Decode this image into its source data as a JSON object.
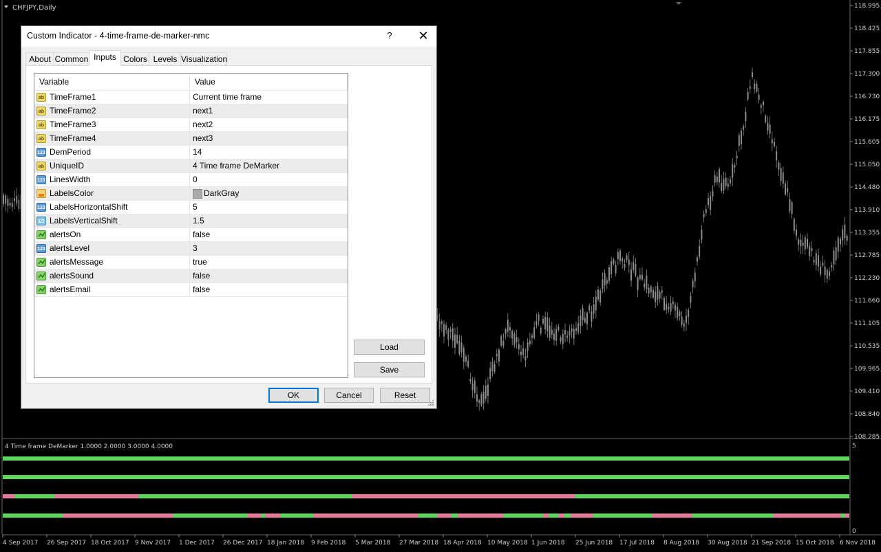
{
  "chart": {
    "symbol_label": "CHFJPY,Daily",
    "indicator_label": "4 Time frame DeMarker 1.0000 2.0000 3.0000 4.0000",
    "price_ticks": [
      "118.995",
      "118.425",
      "117.855",
      "117.300",
      "116.730",
      "116.175",
      "115.605",
      "115.050",
      "114.480",
      "113.910",
      "113.355",
      "112.785",
      "112.230",
      "111.660",
      "111.105",
      "110.535",
      "109.965",
      "109.410",
      "108.840",
      "108.285"
    ],
    "sub_scale_top": "5",
    "sub_scale_bottom": "0",
    "date_ticks": [
      "4 Sep 2017",
      "26 Sep 2017",
      "18 Oct 2017",
      "9 Nov 2017",
      "1 Dec 2017",
      "26 Dec 2017",
      "18 Jan 2018",
      "9 Feb 2018",
      "5 Mar 2018",
      "27 Mar 2018",
      "18 Apr 2018",
      "10 May 2018",
      "1 Jun 2018",
      "25 Jun 2018",
      "17 Jul 2018",
      "8 Aug 2018",
      "30 Aug 2018",
      "21 Sep 2018",
      "15 Oct 2018",
      "6 Nov 2018"
    ],
    "colors": {
      "up": "#5cd65c",
      "down": "#e57a9a",
      "candle": "#8c8c8c",
      "background": "#000000"
    }
  },
  "dialog": {
    "title": "Custom Indicator - 4-time-frame-de-marker-nmc",
    "help_label": "?",
    "close_label": "✕",
    "tabs": [
      "About",
      "Common",
      "Inputs",
      "Colors",
      "Levels",
      "Visualization"
    ],
    "active_tab": "Inputs",
    "columns": {
      "variable": "Variable",
      "value": "Value"
    },
    "rows": [
      {
        "icon": "string",
        "name": "TimeFrame1",
        "value": "Current time frame"
      },
      {
        "icon": "string",
        "name": "TimeFrame2",
        "value": "next1"
      },
      {
        "icon": "string",
        "name": "TimeFrame3",
        "value": "next2"
      },
      {
        "icon": "string",
        "name": "TimeFrame4",
        "value": "next3"
      },
      {
        "icon": "int",
        "name": "DemPeriod",
        "value": "14"
      },
      {
        "icon": "string",
        "name": "UniqueID",
        "value": "4 Time frame DeMarker"
      },
      {
        "icon": "int",
        "name": "LinesWidth",
        "value": "0"
      },
      {
        "icon": "color",
        "name": "LabelsColor",
        "value": "DarkGray",
        "swatch": "#a9a9a9"
      },
      {
        "icon": "int",
        "name": "LabelsHorizontalShift",
        "value": "5"
      },
      {
        "icon": "double",
        "name": "LabelsVerticalShift",
        "value": "1.5"
      },
      {
        "icon": "bool",
        "name": "alertsOn",
        "value": "false"
      },
      {
        "icon": "int",
        "name": "alertsLevel",
        "value": "3"
      },
      {
        "icon": "bool",
        "name": "alertsMessage",
        "value": "true"
      },
      {
        "icon": "bool",
        "name": "alertsSound",
        "value": "false"
      },
      {
        "icon": "bool",
        "name": "alertsEmail",
        "value": "false"
      }
    ],
    "buttons": {
      "load": "Load",
      "save": "Save",
      "ok": "OK",
      "cancel": "Cancel",
      "reset": "Reset"
    }
  }
}
